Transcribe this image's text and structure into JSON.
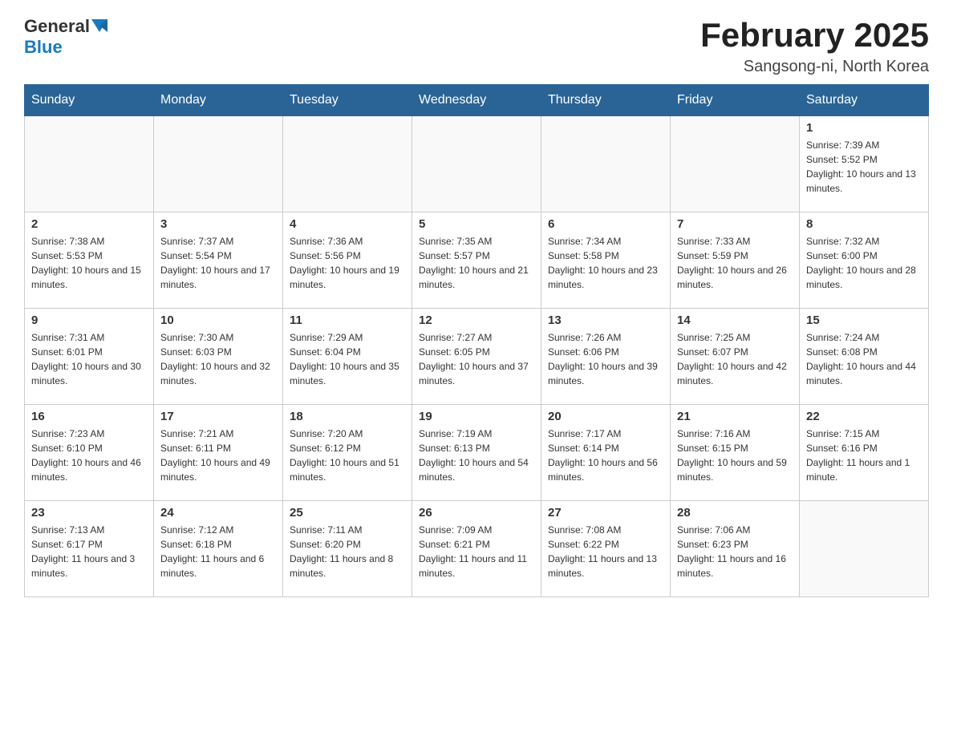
{
  "header": {
    "logo_general": "General",
    "logo_blue": "Blue",
    "month_title": "February 2025",
    "location": "Sangsong-ni, North Korea"
  },
  "days_of_week": [
    "Sunday",
    "Monday",
    "Tuesday",
    "Wednesday",
    "Thursday",
    "Friday",
    "Saturday"
  ],
  "weeks": [
    [
      {
        "day": "",
        "info": ""
      },
      {
        "day": "",
        "info": ""
      },
      {
        "day": "",
        "info": ""
      },
      {
        "day": "",
        "info": ""
      },
      {
        "day": "",
        "info": ""
      },
      {
        "day": "",
        "info": ""
      },
      {
        "day": "1",
        "info": "Sunrise: 7:39 AM\nSunset: 5:52 PM\nDaylight: 10 hours and 13 minutes."
      }
    ],
    [
      {
        "day": "2",
        "info": "Sunrise: 7:38 AM\nSunset: 5:53 PM\nDaylight: 10 hours and 15 minutes."
      },
      {
        "day": "3",
        "info": "Sunrise: 7:37 AM\nSunset: 5:54 PM\nDaylight: 10 hours and 17 minutes."
      },
      {
        "day": "4",
        "info": "Sunrise: 7:36 AM\nSunset: 5:56 PM\nDaylight: 10 hours and 19 minutes."
      },
      {
        "day": "5",
        "info": "Sunrise: 7:35 AM\nSunset: 5:57 PM\nDaylight: 10 hours and 21 minutes."
      },
      {
        "day": "6",
        "info": "Sunrise: 7:34 AM\nSunset: 5:58 PM\nDaylight: 10 hours and 23 minutes."
      },
      {
        "day": "7",
        "info": "Sunrise: 7:33 AM\nSunset: 5:59 PM\nDaylight: 10 hours and 26 minutes."
      },
      {
        "day": "8",
        "info": "Sunrise: 7:32 AM\nSunset: 6:00 PM\nDaylight: 10 hours and 28 minutes."
      }
    ],
    [
      {
        "day": "9",
        "info": "Sunrise: 7:31 AM\nSunset: 6:01 PM\nDaylight: 10 hours and 30 minutes."
      },
      {
        "day": "10",
        "info": "Sunrise: 7:30 AM\nSunset: 6:03 PM\nDaylight: 10 hours and 32 minutes."
      },
      {
        "day": "11",
        "info": "Sunrise: 7:29 AM\nSunset: 6:04 PM\nDaylight: 10 hours and 35 minutes."
      },
      {
        "day": "12",
        "info": "Sunrise: 7:27 AM\nSunset: 6:05 PM\nDaylight: 10 hours and 37 minutes."
      },
      {
        "day": "13",
        "info": "Sunrise: 7:26 AM\nSunset: 6:06 PM\nDaylight: 10 hours and 39 minutes."
      },
      {
        "day": "14",
        "info": "Sunrise: 7:25 AM\nSunset: 6:07 PM\nDaylight: 10 hours and 42 minutes."
      },
      {
        "day": "15",
        "info": "Sunrise: 7:24 AM\nSunset: 6:08 PM\nDaylight: 10 hours and 44 minutes."
      }
    ],
    [
      {
        "day": "16",
        "info": "Sunrise: 7:23 AM\nSunset: 6:10 PM\nDaylight: 10 hours and 46 minutes."
      },
      {
        "day": "17",
        "info": "Sunrise: 7:21 AM\nSunset: 6:11 PM\nDaylight: 10 hours and 49 minutes."
      },
      {
        "day": "18",
        "info": "Sunrise: 7:20 AM\nSunset: 6:12 PM\nDaylight: 10 hours and 51 minutes."
      },
      {
        "day": "19",
        "info": "Sunrise: 7:19 AM\nSunset: 6:13 PM\nDaylight: 10 hours and 54 minutes."
      },
      {
        "day": "20",
        "info": "Sunrise: 7:17 AM\nSunset: 6:14 PM\nDaylight: 10 hours and 56 minutes."
      },
      {
        "day": "21",
        "info": "Sunrise: 7:16 AM\nSunset: 6:15 PM\nDaylight: 10 hours and 59 minutes."
      },
      {
        "day": "22",
        "info": "Sunrise: 7:15 AM\nSunset: 6:16 PM\nDaylight: 11 hours and 1 minute."
      }
    ],
    [
      {
        "day": "23",
        "info": "Sunrise: 7:13 AM\nSunset: 6:17 PM\nDaylight: 11 hours and 3 minutes."
      },
      {
        "day": "24",
        "info": "Sunrise: 7:12 AM\nSunset: 6:18 PM\nDaylight: 11 hours and 6 minutes."
      },
      {
        "day": "25",
        "info": "Sunrise: 7:11 AM\nSunset: 6:20 PM\nDaylight: 11 hours and 8 minutes."
      },
      {
        "day": "26",
        "info": "Sunrise: 7:09 AM\nSunset: 6:21 PM\nDaylight: 11 hours and 11 minutes."
      },
      {
        "day": "27",
        "info": "Sunrise: 7:08 AM\nSunset: 6:22 PM\nDaylight: 11 hours and 13 minutes."
      },
      {
        "day": "28",
        "info": "Sunrise: 7:06 AM\nSunset: 6:23 PM\nDaylight: 11 hours and 16 minutes."
      },
      {
        "day": "",
        "info": ""
      }
    ]
  ]
}
